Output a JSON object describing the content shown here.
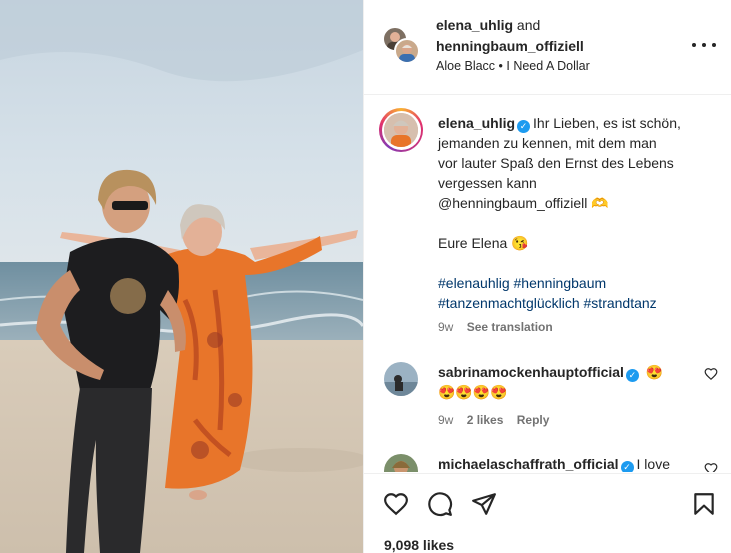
{
  "header": {
    "user1": "elena_uhlig",
    "and_text": "and",
    "user2": "henningbaum_offiziell",
    "audio": "Aloe Blacc • I Need A Dollar"
  },
  "caption": {
    "username": "elena_uhlig",
    "line1": "Ihr Lieben, es ist schön,",
    "line2": "jemanden zu kennen, mit dem man",
    "line3": "vor lauter Spaß den Ernst des Lebens",
    "line4": "vergessen kann",
    "mention": "@henningbaum_offiziell 🫶",
    "signoff": "Eure Elena 😘",
    "hashtags1": "#elenauhlig #henningbaum",
    "hashtags2": "#tanzenmachtglücklich #strandtanz",
    "time": "9w",
    "see_translation": "See translation"
  },
  "comments": [
    {
      "username": "sabrinamockenhauptofficial",
      "line1_emoji": "😍",
      "line2": "😍😍😍😍",
      "time": "9w",
      "likes": "2 likes",
      "reply": "Reply"
    },
    {
      "username": "michaelaschaffrath_official",
      "text": "I love"
    }
  ],
  "footer": {
    "likes": "9,098 likes"
  },
  "icons": {
    "more": "more-options-icon",
    "like": "heart-icon",
    "comment": "comment-icon",
    "share": "share-icon",
    "save": "bookmark-icon",
    "verified": "verified-badge-icon"
  },
  "colors": {
    "verified": "#1d9bf0",
    "muted": "#737373",
    "text": "#262626"
  }
}
